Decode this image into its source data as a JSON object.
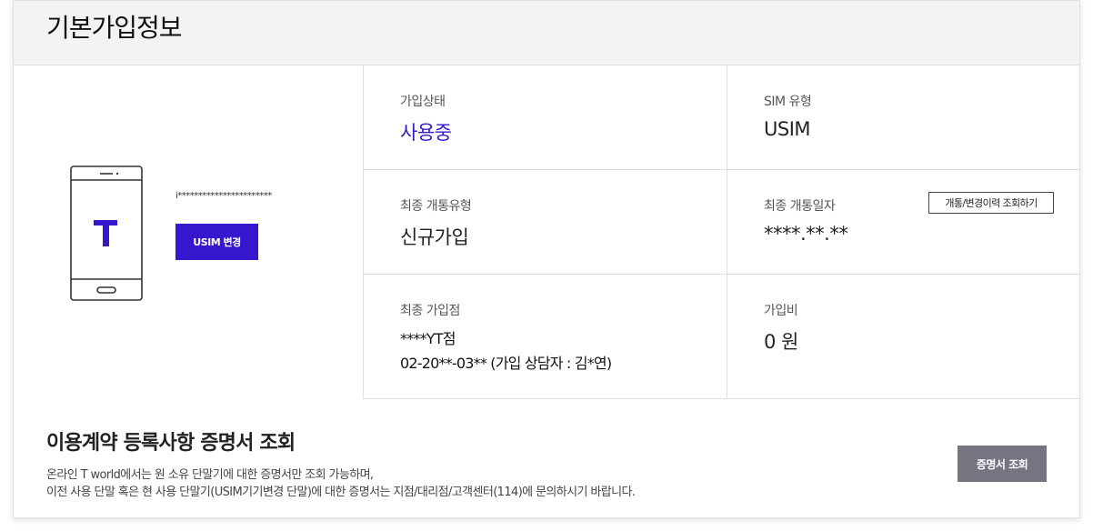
{
  "header": {
    "title": "기본가입정보"
  },
  "device": {
    "masked_id": "i***********************",
    "usim_change_label": "USIM 변경",
    "brand_glyph": "T",
    "brand_color": "#3617ce"
  },
  "info": {
    "status": {
      "label": "가입상태",
      "value": "사용중"
    },
    "sim_type": {
      "label": "SIM 유형",
      "value": "USIM"
    },
    "last_activation_type": {
      "label": "최종 개통유형",
      "value": "신규가입"
    },
    "last_activation_date": {
      "label": "최종 개통일자",
      "value": "****.**.**",
      "history_button": "개통/변경이력 조회하기"
    },
    "last_store": {
      "label": "최종 가입점",
      "store_name": "****YT점",
      "store_contact": "02-20**-03** (가입 상담자 : 김*연)"
    },
    "join_fee": {
      "label": "가입비",
      "value": "0 원"
    }
  },
  "certificate": {
    "title": "이용계약 등록사항 증명서 조회",
    "desc_line1": "온라인 T world에서는 원 소유 단말기에 대한 증명서만 조회 가능하며,",
    "desc_line2": "이전 사용 단말 혹은 현 사용 단말기(USIM기기변경 단말)에 대한 증명서는 지점/대리점/고객센터(114)에 문의하시기 바랍니다.",
    "button_label": "증명서 조회"
  },
  "colors": {
    "accent": "#3617ce",
    "secondary_button": "#777482"
  }
}
